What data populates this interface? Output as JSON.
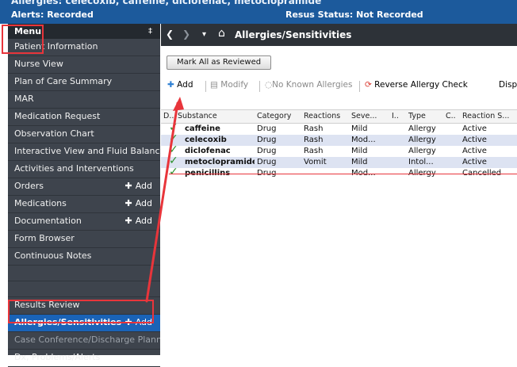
{
  "banner": {
    "clipped_text": "Allergies: celecoxib, caffeine, diclofenac, metoclopramide",
    "alerts": "Alerts: Recorded",
    "resus": "Resus Status: Not Recorded"
  },
  "menu": {
    "title": "Menu",
    "pin": "‡",
    "add_label": "Add",
    "items": [
      "Patient Information",
      "Nurse View",
      "Plan of Care Summary",
      "MAR",
      "Medication Request",
      "Observation Chart",
      "Interactive View and Fluid Balance",
      "Activities and Interventions",
      "Orders",
      "Medications",
      "Documentation",
      "Form Browser",
      "Continuous Notes",
      "Results Review",
      "Allergies/Sensitivities",
      "Case Conference/Discharge Planni...",
      "Dx, Problems/Alerts"
    ]
  },
  "header": {
    "back": "❮",
    "forward": "❯",
    "dropdown": "▾",
    "home": "⌂",
    "title": "Allergies/Sensitivities"
  },
  "toolbar": {
    "mark_all": "Mark All as Reviewed",
    "add": "Add",
    "modify": "Modify",
    "no_known": "No Known Allergies",
    "reverse": "Reverse Allergy Check",
    "display": "Disp"
  },
  "table": {
    "headers": [
      "D..",
      "Substance",
      "Category",
      "Reactions",
      "Seve...",
      "I..",
      "Type",
      "C..",
      "Reaction S..."
    ],
    "rows": [
      [
        "caffeine",
        "Drug",
        "Rash",
        "Mild",
        "",
        "Allergy",
        "",
        "Active"
      ],
      [
        "celecoxib",
        "Drug",
        "Rash",
        "Mod...",
        "",
        "Allergy",
        "",
        "Active"
      ],
      [
        "diclofenac",
        "Drug",
        "Rash",
        "Mild",
        "",
        "Allergy",
        "",
        "Active"
      ],
      [
        "metoclopramide",
        "Drug",
        "Vomit",
        "Mild",
        "",
        "Intol...",
        "",
        "Active"
      ],
      [
        "penicillins",
        "Drug",
        "",
        "Mod...",
        "",
        "Allergy",
        "",
        "Cancelled"
      ]
    ]
  },
  "colors": {
    "accent": "#1a63b7",
    "highlight": "#e8353b",
    "check": "#2c8f2c"
  }
}
